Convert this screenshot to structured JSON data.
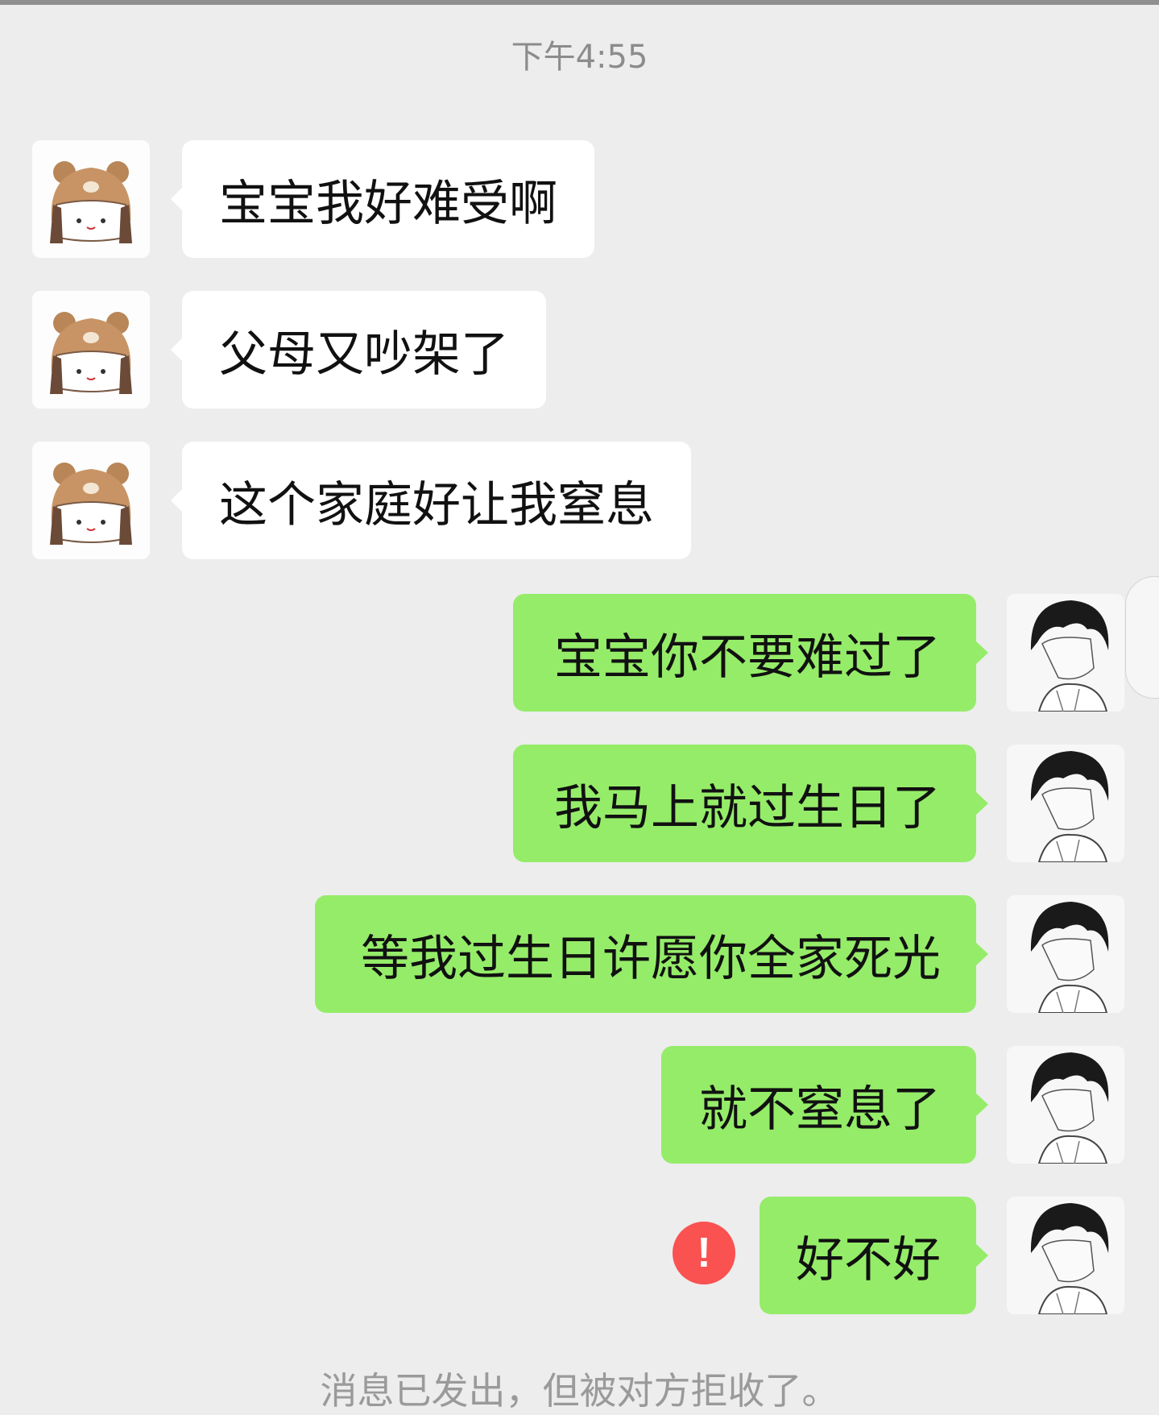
{
  "chat": {
    "timestamp": "下午4:55",
    "incoming": [
      {
        "text": "宝宝我好难受啊",
        "avatar": "bear-hat-girl-avatar"
      },
      {
        "text": "父母又吵架了",
        "avatar": "bear-hat-girl-avatar"
      },
      {
        "text": "这个家庭好让我窒息",
        "avatar": "bear-hat-girl-avatar"
      }
    ],
    "outgoing": [
      {
        "text": "宝宝你不要难过了",
        "avatar": "anime-boy-avatar"
      },
      {
        "text": "我马上就过生日了",
        "avatar": "anime-boy-avatar"
      },
      {
        "text": "等我过生日许愿你全家死光",
        "avatar": "anime-boy-avatar"
      },
      {
        "text": "就不窒息了",
        "avatar": "anime-boy-avatar"
      },
      {
        "text": "好不好",
        "avatar": "anime-boy-avatar",
        "failed": true
      }
    ],
    "error_icon": "!",
    "system_notice": "消息已发出，但被对方拒收了。"
  },
  "colors": {
    "background": "#ededed",
    "incoming_bubble": "#ffffff",
    "outgoing_bubble": "#95ec69",
    "error": "#fa5151"
  }
}
